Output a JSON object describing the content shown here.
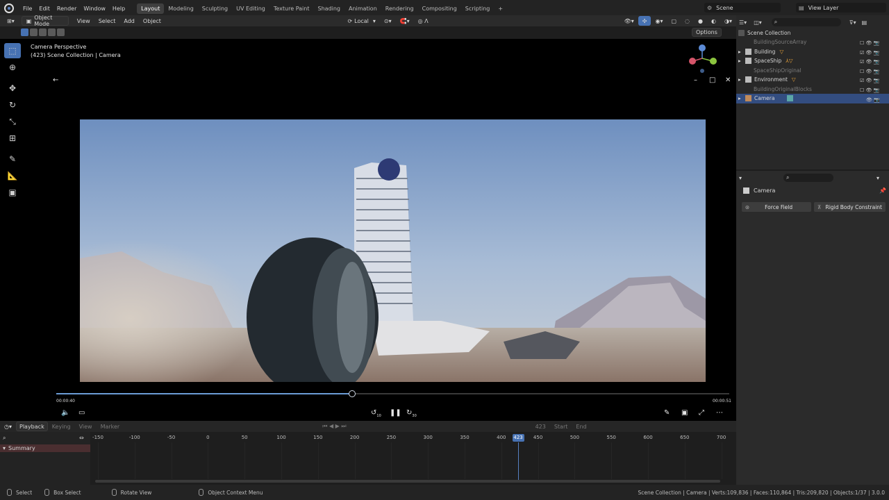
{
  "topbar": {
    "menus": [
      "File",
      "Edit",
      "Render",
      "Window",
      "Help"
    ],
    "workspaces": [
      "Layout",
      "Modeling",
      "Sculpting",
      "UV Editing",
      "Texture Paint",
      "Shading",
      "Animation",
      "Rendering",
      "Compositing",
      "Scripting"
    ],
    "active_workspace": "Layout",
    "add_tab": "+",
    "scene_label": "Scene",
    "view_layer_label": "View Layer"
  },
  "viewport_header": {
    "mode": "Object Mode",
    "menus": [
      "View",
      "Select",
      "Add",
      "Object"
    ],
    "pivot": "Local",
    "options": "Options"
  },
  "viewport": {
    "title": "Camera Perspective",
    "subtitle": "(423) Scene Collection | Camera"
  },
  "player": {
    "time_current": "00:00:40",
    "time_total": "00:00:51",
    "progress": 0.44,
    "rewind_label": "10",
    "forward_label": "30"
  },
  "outliner": {
    "root": "Scene Collection",
    "items": [
      {
        "label": "BuildingSourceArray",
        "dim": true,
        "selected": false
      },
      {
        "label": "Building",
        "dim": false,
        "selected": false
      },
      {
        "label": "SpaceShip",
        "dim": false,
        "selected": false
      },
      {
        "label": "SpaceShipOriginal",
        "dim": true,
        "selected": false
      },
      {
        "label": "Environment",
        "dim": false,
        "selected": false
      },
      {
        "label": "BuildingOriginalBlocks",
        "dim": true,
        "selected": false
      },
      {
        "label": "Camera",
        "dim": false,
        "selected": true
      }
    ]
  },
  "properties": {
    "object_name": "Camera",
    "buttons": [
      "Force Field",
      "Rigid Body Constraint"
    ]
  },
  "timeline": {
    "menus": [
      "Playback",
      "Keying",
      "View",
      "Marker"
    ],
    "summary_label": "Summary",
    "ticks": [
      "-150",
      "-100",
      "-50",
      "0",
      "50",
      "100",
      "150",
      "200",
      "250",
      "300",
      "350",
      "400",
      "450",
      "500",
      "550",
      "600",
      "650",
      "700"
    ],
    "current_frame": "423",
    "start_label": "Start",
    "end_label": "End"
  },
  "statusbar": {
    "items": [
      "Select",
      "Box Select",
      "Rotate View",
      "Object Context Menu"
    ],
    "stats": "Scene Collection | Camera | Verts:109,836 | Faces:110,864 | Tris:209,820 | Objects:1/37 | 3.0.0"
  },
  "colors": {
    "accent": "#4772b3",
    "selection": "#334d80",
    "seek": "#6b9cd6"
  }
}
